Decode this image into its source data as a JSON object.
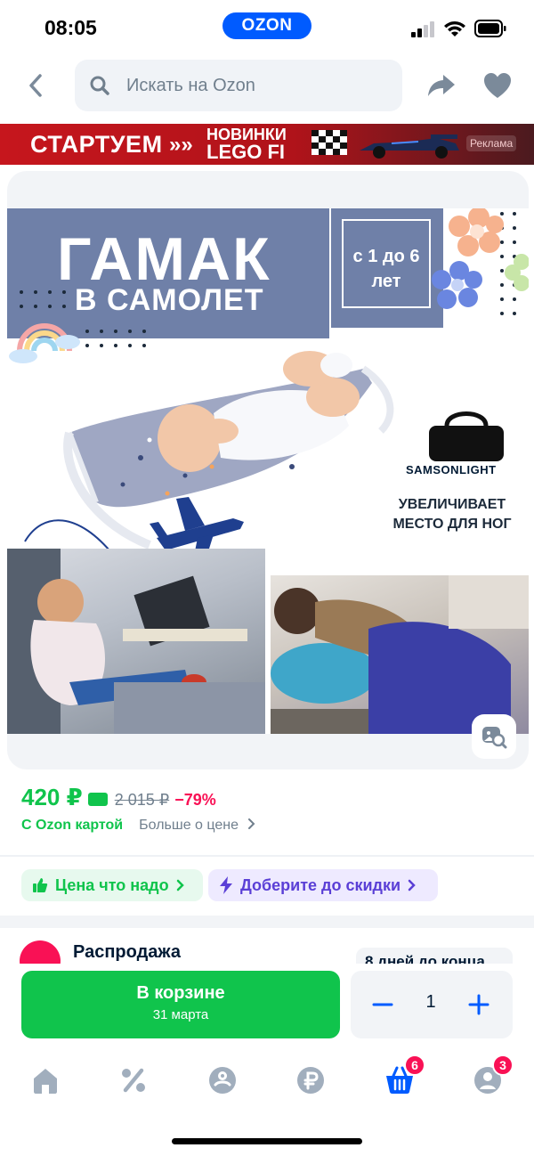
{
  "status_bar": {
    "time": "08:05",
    "logo": "OZON",
    "icons": [
      "signal-icon",
      "wifi-icon",
      "battery-icon"
    ]
  },
  "header": {
    "search_placeholder": "Искать на Ozon",
    "icons": [
      "back-arrow-icon",
      "search-icon",
      "share-icon",
      "heart-icon"
    ]
  },
  "promo": {
    "left_text": "СТАРТУЕМ",
    "chevrons": "»»",
    "right_line1": "НОВИНКИ",
    "right_line2": "LEGO FI",
    "ad_label": "Реклама"
  },
  "product_image": {
    "title_line1": "ГАМАК",
    "title_line2": "В САМОЛЕТ",
    "age_line1": "с 1 до 6",
    "age_line2": "лет",
    "brand": "SAMSONLIGHT",
    "feature_line1": "УВЕЛИЧИВАЕТ",
    "feature_line2": "МЕСТО ДЛЯ НОГ"
  },
  "price": {
    "current": "420 ₽",
    "old": "2 015 ₽",
    "discount": "−79%",
    "card_label": "С Ozon картой",
    "more_label": "Больше о цене"
  },
  "chips": {
    "good_price": "Цена что надо",
    "discount": "Доберите до скидки"
  },
  "sale": {
    "title": "Распродажа",
    "timer": "8 дней до конца"
  },
  "cart": {
    "button_label": "В корзине",
    "delivery_date": "31 марта",
    "quantity": "1"
  },
  "tab_bar": {
    "tabs": [
      "home-icon",
      "discount-icon",
      "fresh-icon",
      "finance-icon",
      "cart-icon",
      "profile-icon"
    ],
    "cart_badge": "6",
    "profile_badge": "3"
  },
  "colors": {
    "brand_blue": "#005bff",
    "green": "#10c44c",
    "pink": "#f91155",
    "icon_gray": "#a1aebd",
    "purple": "#5a3fd6"
  }
}
